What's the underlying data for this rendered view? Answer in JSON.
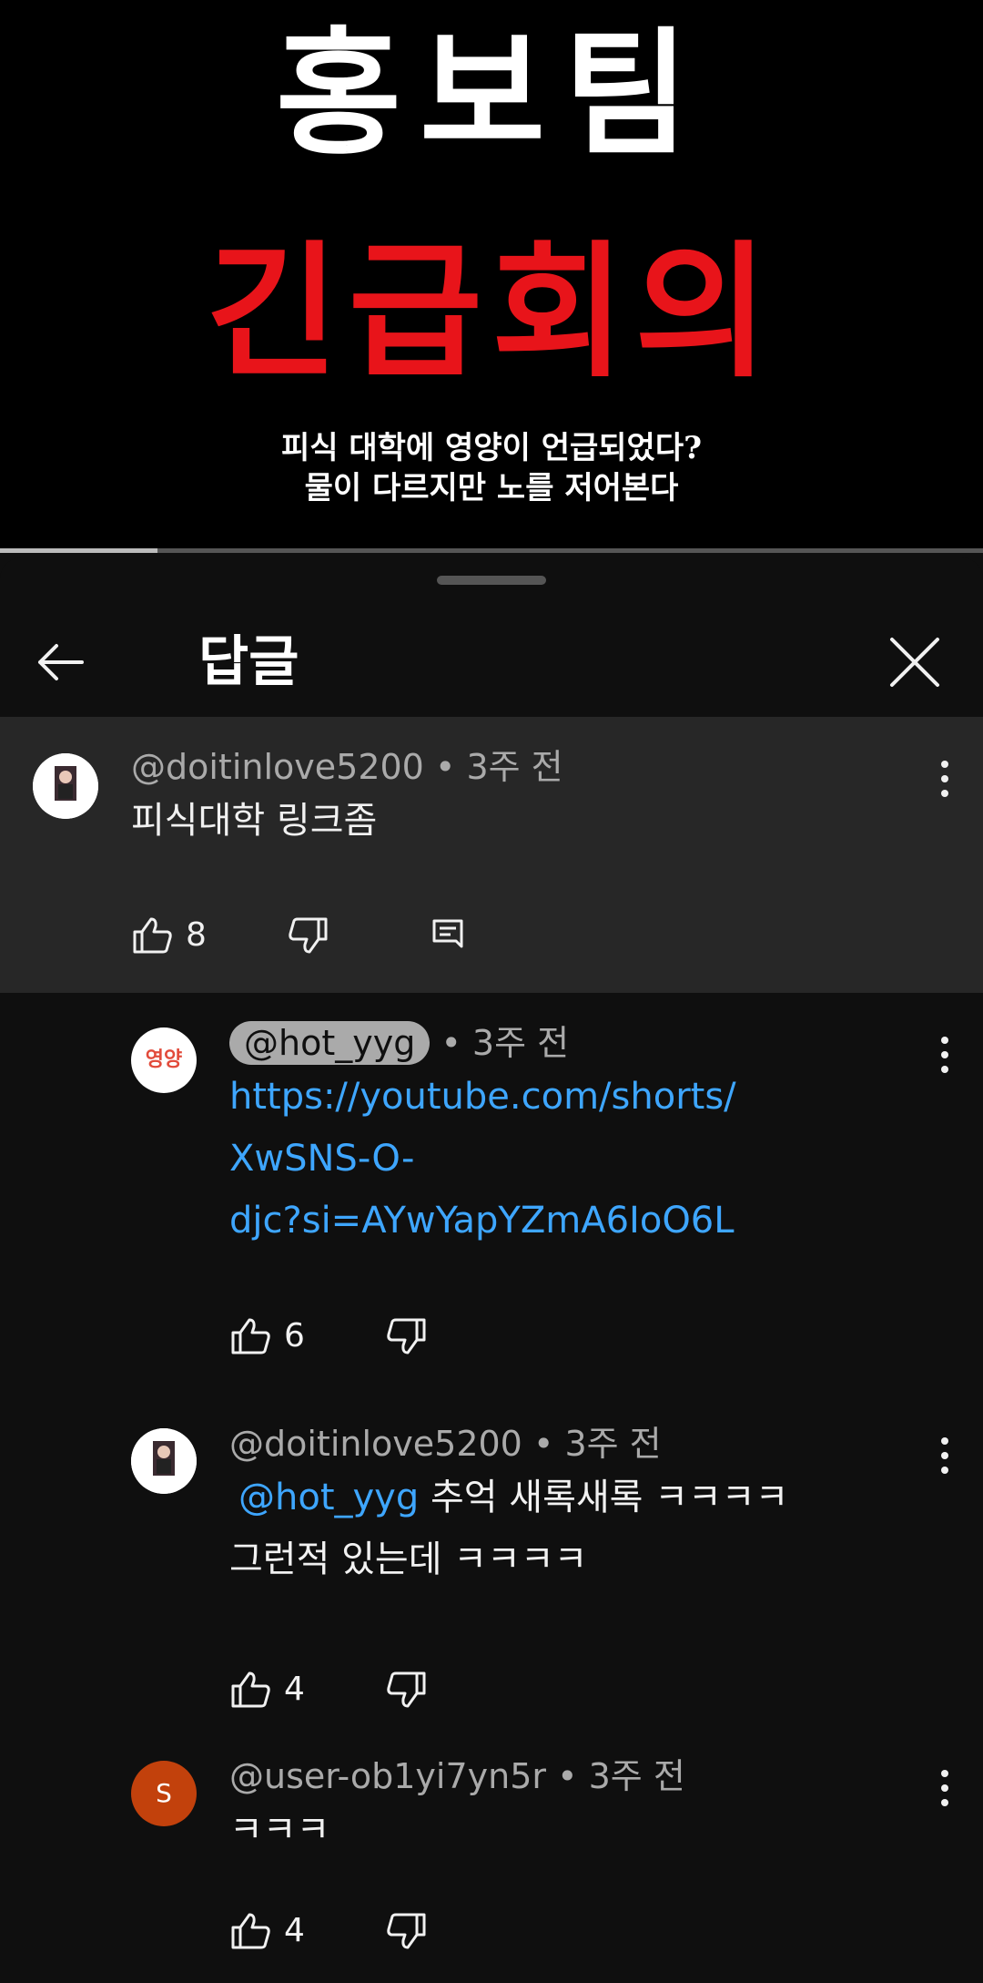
{
  "video": {
    "title": "홍보팀",
    "headline": "긴급회의",
    "subtitle_line1": "피식 대학에 영양이 언급되었다?",
    "subtitle_line2": "물이 다르지만 노를 저어본다",
    "progress": 0.16
  },
  "sheet": {
    "title": "답글",
    "back_icon": "arrow-left-icon",
    "close_icon": "close-icon"
  },
  "comments": [
    {
      "author": "@doitinlove5200",
      "time": "• 3주 전",
      "text": "피식대학 링크좀",
      "likes": "8",
      "has_reply_button": true
    },
    {
      "author": "@hot_yyg",
      "time": "• 3주 전",
      "link_line1": "https://youtube.com/shorts/",
      "link_line2": "XwSNS-O-",
      "link_line3": "djc?si=AYwYapYZmA6IoO6L",
      "likes": "6",
      "avatar_text": "영양"
    },
    {
      "author": "@doitinlove5200",
      "time": "• 3주 전",
      "mention": "@hot_yyg",
      "text_line1": " 추억 새록새록 ㅋㅋㅋㅋ",
      "text_line2": "그런적 있는데 ㅋㅋㅋㅋ",
      "likes": "4"
    },
    {
      "author": "@user-ob1yi7yn5r",
      "time": "• 3주 전",
      "text": "ㅋㅋㅋ",
      "likes": "4",
      "avatar_letter": "S",
      "avatar_color": "#c2410c"
    }
  ],
  "colors": {
    "background": "#0f0f0f",
    "highlight": "#272727",
    "link": "#3ea6ff",
    "headline_red": "#e8141a"
  }
}
